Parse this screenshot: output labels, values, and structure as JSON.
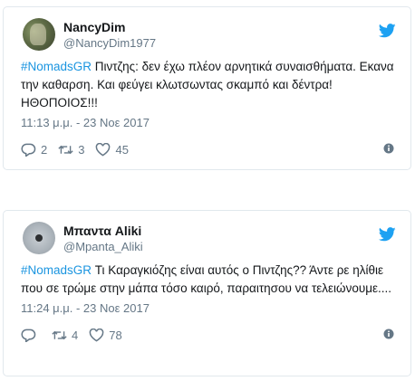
{
  "tweets": [
    {
      "display_name": "NancyDim",
      "handle": "@NancyDim1977",
      "hashtag": "#NomadsGR",
      "text": " Πιντζης: δεν έχω πλέον αρνητικά συναισθήματα. Εκανα την καθαρση. Και φεύγει κλωτσωντας σκαμπό και δέντρα! ΗΘΟΠΟΙΟΣ!!!",
      "timestamp": "11:13 μ.μ. - 23 Νοε 2017",
      "replies": "2",
      "retweets": "3",
      "likes": "45"
    },
    {
      "display_name": "Mπαντα Aliki",
      "handle": "@Mpanta_Aliki",
      "hashtag": "#NomadsGR",
      "text": " Τι Καραγκιόζης είναι αυτός ο Πιντζης?? Άντε ρε ηλίθιε που σε τρώμε στην μάπα τόσο καιρό, παραιτησου να τελειώνουμε....",
      "timestamp": "11:24 μ.μ. - 23 Νοε 2017",
      "replies": "",
      "retweets": "4",
      "likes": "78"
    }
  ],
  "colors": {
    "brand": "#1da1f2",
    "hashtag": "#1b95e0",
    "secondary_text": "#657786",
    "border": "#e1e8ed"
  },
  "icons": [
    "twitter-bird-icon",
    "reply-icon",
    "retweet-icon",
    "like-icon",
    "info-icon"
  ]
}
